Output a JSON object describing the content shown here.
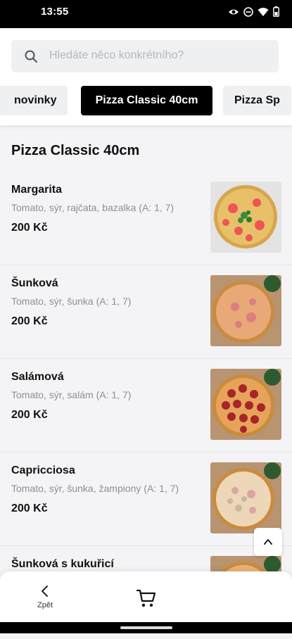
{
  "status_bar": {
    "time": "13:55"
  },
  "search": {
    "placeholder": "Hledáte něco konkrétního?"
  },
  "tabs": [
    {
      "label": "novinky",
      "active": false
    },
    {
      "label": "Pizza Classic 40cm",
      "active": true
    },
    {
      "label": "Pizza Sp",
      "active": false
    }
  ],
  "section": {
    "title": "Pizza Classic 40cm"
  },
  "items": [
    {
      "name": "Margarita",
      "desc": "Tomato, sýr, rajčata, bazalka (A: 1, 7)",
      "price": "200 Kč"
    },
    {
      "name": "Šunková",
      "desc": "Tomato, sýr, šunka (A: 1, 7)",
      "price": "200 Kč"
    },
    {
      "name": "Salámová",
      "desc": "Tomato, sýr, salám (A: 1, 7)",
      "price": "200 Kč"
    },
    {
      "name": "Capricciosa",
      "desc": "Tomato, sýr, šunka, žampiony (A: 1, 7)",
      "price": "200 Kč"
    },
    {
      "name": "Šunková s kukuřicí",
      "desc": "",
      "price": ""
    }
  ],
  "bottom_bar": {
    "back_label": "Zpět"
  },
  "icons": {
    "search": "search-icon",
    "scroll_top": "chevron-up-icon",
    "back": "chevron-left-icon",
    "cart": "cart-icon"
  },
  "colors": {
    "accent": "#000000",
    "background": "#f4f4f6",
    "muted_text": "#8a8f96"
  }
}
